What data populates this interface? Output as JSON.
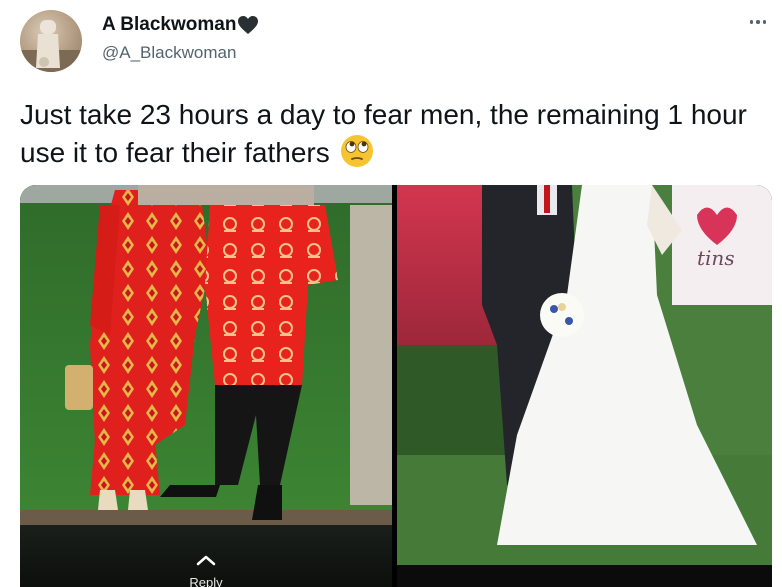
{
  "tweet": {
    "display_name": "A Blackwoman",
    "name_emoji": "black-heart",
    "handle": "@A_Blackwoman",
    "text": "Just take 23 hours a day to fear men, the remaining 1 hour use it to fear their fathers",
    "text_emoji": "face-with-rolling-eyes"
  },
  "media": {
    "reply_label": "Reply",
    "right_sign_text": "tins"
  },
  "colors": {
    "text_primary": "#0f1419",
    "text_secondary": "#536471",
    "emoji_yellow": "#f7c431"
  }
}
